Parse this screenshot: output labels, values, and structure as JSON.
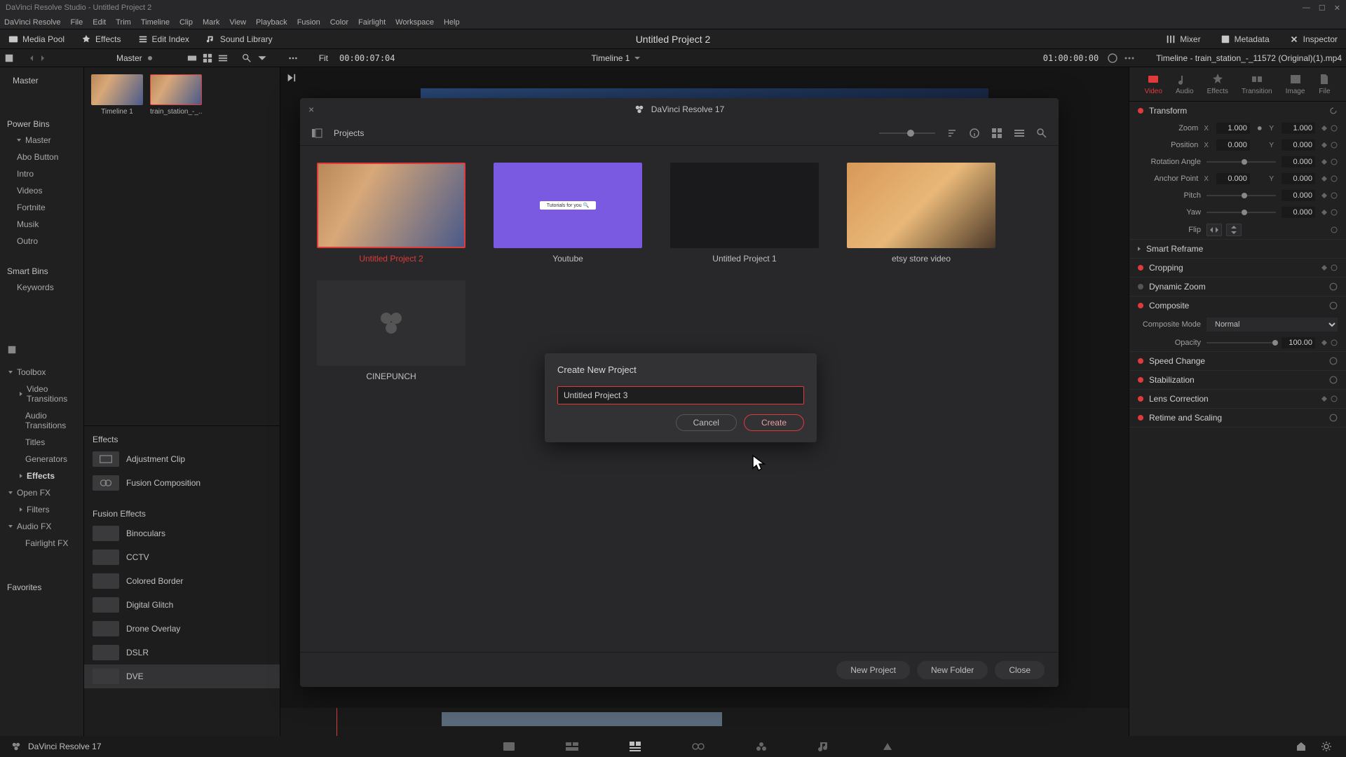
{
  "titlebar": {
    "text": "DaVinci Resolve Studio - Untitled Project 2"
  },
  "menu": [
    "DaVinci Resolve",
    "File",
    "Edit",
    "Trim",
    "Timeline",
    "Clip",
    "Mark",
    "View",
    "Playback",
    "Fusion",
    "Color",
    "Fairlight",
    "Workspace",
    "Help"
  ],
  "toolbar": {
    "media_pool": "Media Pool",
    "effects": "Effects",
    "edit_index": "Edit Index",
    "sound_library": "Sound Library",
    "mixer": "Mixer",
    "metadata": "Metadata",
    "inspector": "Inspector",
    "project_title": "Untitled Project 2"
  },
  "secondary": {
    "master": "Master",
    "fit": "Fit",
    "timecode_left": "00:00:07:04",
    "timeline_name": "Timeline 1",
    "timecode_right": "01:00:00:00",
    "inspector_clip": "Timeline - train_station_-_11572 (Original)(1).mp4"
  },
  "sidebar": {
    "master_root": "Master",
    "power_bins": "Power Bins",
    "master_sub": "Master",
    "items": [
      "Abo Button",
      "Intro",
      "Videos",
      "Fortnite",
      "Musik",
      "Outro"
    ],
    "smart_bins": "Smart Bins",
    "keywords": "Keywords",
    "toolbox": "Toolbox",
    "toolbox_items": [
      "Video Transitions",
      "Audio Transitions",
      "Titles",
      "Generators"
    ],
    "effects_cat": "Effects",
    "openfx": "Open FX",
    "filters": "Filters",
    "audiofx": "Audio FX",
    "fairlightfx": "Fairlight FX",
    "favorites": "Favorites"
  },
  "clips": {
    "c1": "Timeline 1",
    "c2": "train_station_-_..."
  },
  "effects_panel": {
    "header": "Effects",
    "items": [
      "Adjustment Clip",
      "Fusion Composition"
    ],
    "fusion_header": "Fusion Effects",
    "fusion_items": [
      "Binoculars",
      "CCTV",
      "Colored Border",
      "Digital Glitch",
      "Drone Overlay",
      "DSLR",
      "DVE"
    ]
  },
  "inspector_panel": {
    "tabs": [
      "Video",
      "Audio",
      "Effects",
      "Transition",
      "Image",
      "File"
    ],
    "transform": "Transform",
    "zoom": "Zoom",
    "zoom_x": "1.000",
    "zoom_y": "1.000",
    "position": "Position",
    "pos_x": "0.000",
    "pos_y": "0.000",
    "rotation": "Rotation Angle",
    "rot_val": "0.000",
    "anchor": "Anchor Point",
    "anchor_x": "0.000",
    "anchor_y": "0.000",
    "pitch": "Pitch",
    "pitch_val": "0.000",
    "yaw": "Yaw",
    "yaw_val": "0.000",
    "flip": "Flip",
    "smart_reframe": "Smart Reframe",
    "cropping": "Cropping",
    "dynamic_zoom": "Dynamic Zoom",
    "composite": "Composite",
    "composite_mode": "Composite Mode",
    "composite_mode_val": "Normal",
    "opacity": "Opacity",
    "opacity_val": "100.00",
    "speed_change": "Speed Change",
    "stabilization": "Stabilization",
    "lens_correction": "Lens Correction",
    "retime_scaling": "Retime and Scaling"
  },
  "project_manager": {
    "app_name": "DaVinci Resolve 17",
    "projects_label": "Projects",
    "projects": [
      {
        "name": "Untitled Project 2",
        "active": true
      },
      {
        "name": "Youtube"
      },
      {
        "name": "Untitled Project 1"
      },
      {
        "name": "etsy store video"
      },
      {
        "name": "CINEPUNCH",
        "placeholder": true
      }
    ],
    "new_project": "New Project",
    "new_folder": "New Folder",
    "close": "Close"
  },
  "create_dialog": {
    "title": "Create New Project",
    "value": "Untitled Project 3",
    "cancel": "Cancel",
    "create": "Create"
  },
  "footer": {
    "app": "DaVinci Resolve 17"
  }
}
